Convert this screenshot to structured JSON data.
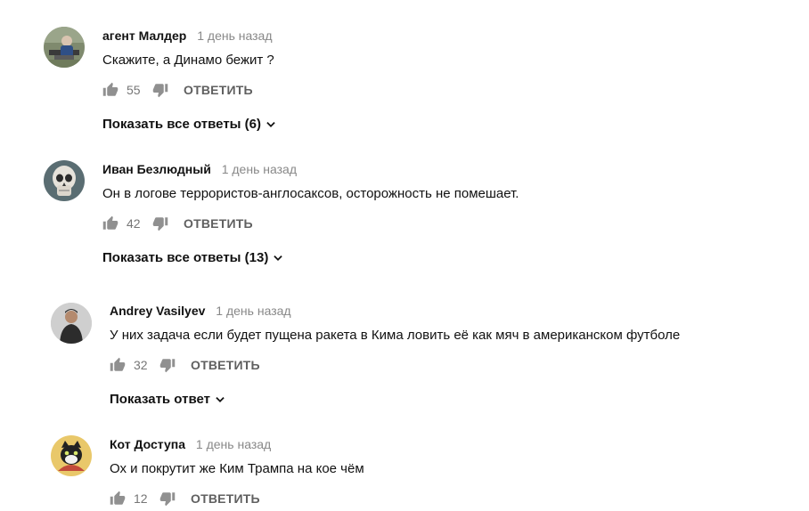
{
  "comments": [
    {
      "author": "агент Малдер",
      "time": "1 день назад",
      "text": "Скажите, а Динамо бежит ?",
      "likes": "55",
      "reply_label": "ОТВЕТИТЬ",
      "show_replies": "Показать все ответы (6)",
      "avatar_icon": "avatar-photo-man-on-bench"
    },
    {
      "author": "Иван Безлюдный",
      "time": "1 день назад",
      "text": "Он в логове террористов-англосаксов, осторожность не помешает.",
      "likes": "42",
      "reply_label": "ОТВЕТИТЬ",
      "show_replies": "Показать все ответы (13)",
      "avatar_icon": "avatar-skull"
    },
    {
      "author": "Andrey Vasilyev",
      "time": "1 день назад",
      "text": "У них задача если будет пущена ракета в Кима ловить её как мяч в американском футболе",
      "likes": "32",
      "reply_label": "ОТВЕТИТЬ",
      "show_replies": "Показать ответ",
      "avatar_icon": "avatar-person-photo"
    },
    {
      "author": "Кот Доступа",
      "time": "1 день назад",
      "text": "Ох и покрутит же Ким Трампа на кое чём",
      "likes": "12",
      "reply_label": "ОТВЕТИТЬ",
      "avatar_icon": "avatar-cat"
    }
  ],
  "colors": {
    "meta": "#888888",
    "icon": "#909090",
    "text": "#111111"
  }
}
